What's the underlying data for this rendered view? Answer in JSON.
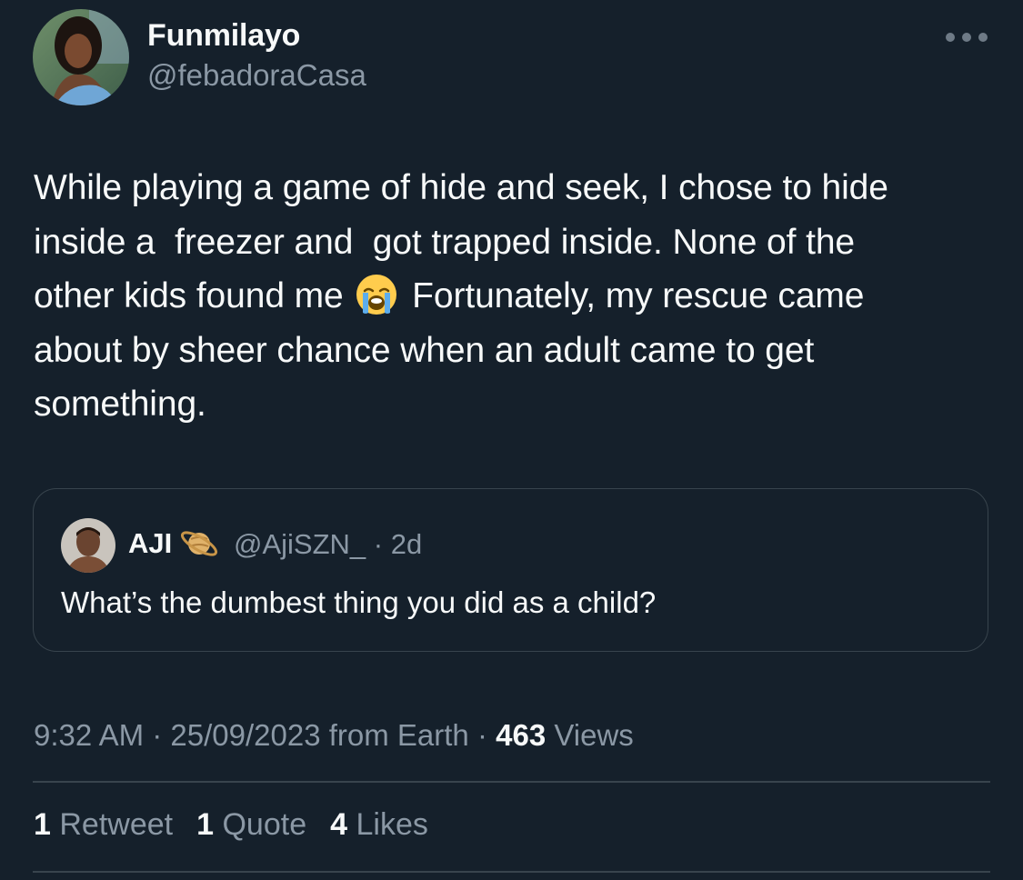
{
  "tweet": {
    "author": {
      "display_name": "Funmilayo",
      "handle": "@febadoraCasa",
      "avatar": "profile-photo"
    },
    "more_icon": "more-horizontal-icon",
    "text_lines": [
      "While playing a game of hide and seek, I chose to hide",
      "inside a  freezer and  got trapped inside. None of the",
      "other kids found me",
      "Fortunately, my rescue came",
      "about by sheer chance when an adult came to get",
      "something."
    ],
    "emoji": "loudly-crying-face",
    "quoted": {
      "display_name": "AJI",
      "badge_icon": "saturn-emoji",
      "handle_time": "@AjiSZN_ · 2d",
      "text": "What’s the dumbest thing you did as a child?"
    },
    "meta": {
      "time_date_source": "9:32 AM · 25/09/2023 from Earth · ",
      "views_count": "463",
      "views_label": " Views"
    },
    "stats": {
      "retweets_count": "1",
      "retweets_label": " Retweet",
      "quotes_count": "1",
      "quotes_label": " Quote",
      "likes_count": "4",
      "likes_label": " Likes"
    }
  },
  "colors": {
    "background": "#15202b",
    "primary_text": "#f7f9f9",
    "secondary_text": "#8b98a5",
    "border": "#38444d"
  }
}
